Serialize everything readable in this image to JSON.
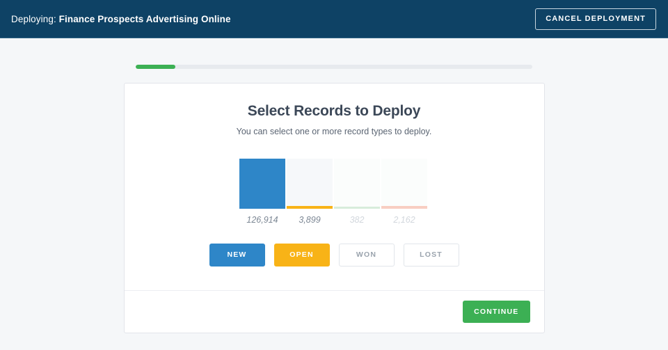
{
  "header": {
    "label": "Deploying:",
    "name": "Finance Prospects Advertising Online",
    "cancel_label": "CANCEL DEPLOYMENT",
    "background_color": "#0e4265"
  },
  "progress": {
    "percent": 10,
    "fill_color": "#3cb054",
    "track_color": "#e7eaee"
  },
  "card": {
    "title": "Select Records to Deploy",
    "subtitle": "You can select one or more record types to deploy.",
    "continue_label": "CONTINUE",
    "continue_color": "#3cb054"
  },
  "chart_data": {
    "type": "bar",
    "title": "Select Records to Deploy",
    "categories": [
      "NEW",
      "OPEN",
      "WON",
      "LOST"
    ],
    "values": [
      126914,
      382,
      2162,
      3899
    ],
    "value_labels": [
      "126,914",
      "3,899",
      "382",
      "2,162"
    ],
    "ordered_values": [
      126914,
      3899,
      382,
      2162
    ],
    "ordered_categories": [
      "NEW",
      "OPEN",
      "WON",
      "LOST"
    ],
    "series": [
      {
        "name": "record counts",
        "values": [
          126914,
          3899,
          382,
          2162
        ]
      }
    ],
    "bar_fill_colors": [
      "#2e86c8",
      "#f8b317",
      "#d7ecdb",
      "#f8cec2"
    ],
    "bar_track_colors": [
      "#f6f8fa",
      "#f6f8fa",
      "#fbfdfc",
      "#fbfdfc"
    ],
    "bar_fill_percent": [
      100,
      5,
      4,
      5
    ],
    "selected": [
      true,
      true,
      false,
      false
    ],
    "xlabel": "",
    "ylabel": "",
    "grid": false,
    "legend": "none"
  },
  "record_types": [
    {
      "label": "NEW",
      "value_label": "126,914",
      "value": 126914,
      "selected": true,
      "toggle_class": "sel-blue",
      "fill_color": "#2e86c8",
      "track_class": "",
      "fill_percent": 100,
      "value_muted": false
    },
    {
      "label": "OPEN",
      "value_label": "3,899",
      "value": 3899,
      "selected": true,
      "toggle_class": "sel-yellow",
      "fill_color": "#f8b317",
      "track_class": "",
      "fill_percent": 5,
      "value_muted": false
    },
    {
      "label": "WON",
      "value_label": "382",
      "value": 382,
      "selected": false,
      "toggle_class": "unsel",
      "fill_color": "#d7ecdb",
      "track_class": "faded",
      "fill_percent": 4,
      "value_muted": true
    },
    {
      "label": "LOST",
      "value_label": "2,162",
      "value": 2162,
      "selected": false,
      "toggle_class": "unsel",
      "fill_color": "#f8cec2",
      "track_class": "faded",
      "fill_percent": 5,
      "value_muted": true
    }
  ]
}
